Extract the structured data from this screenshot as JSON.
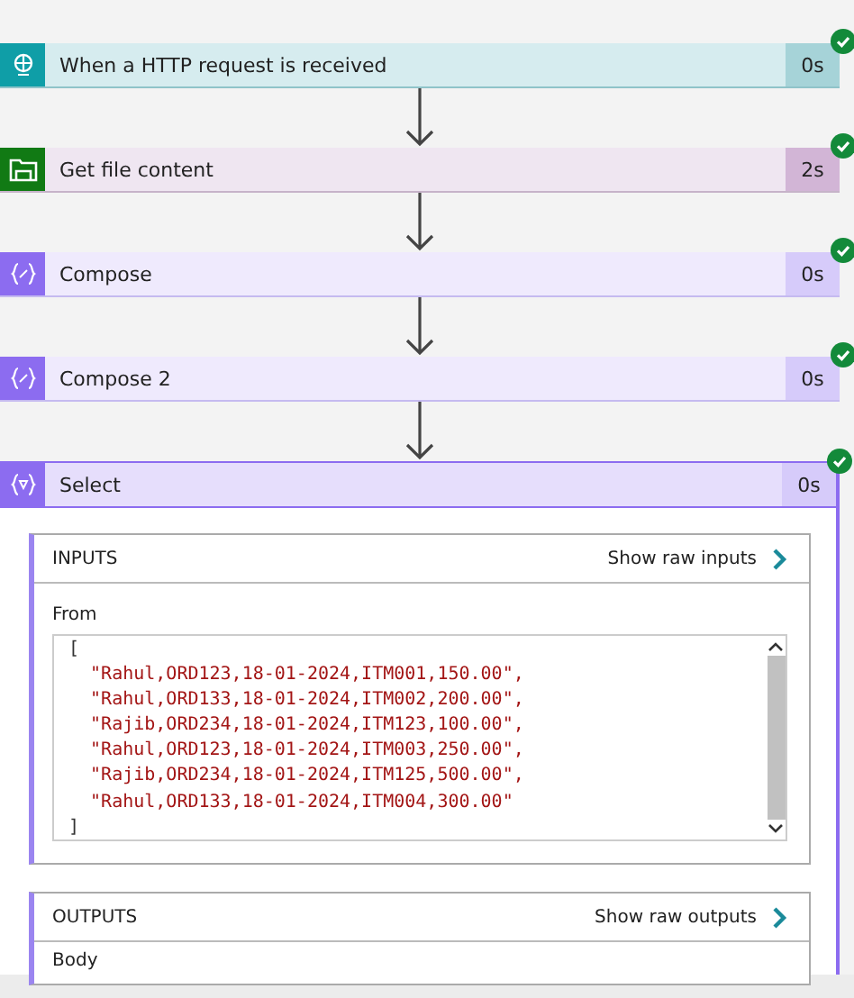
{
  "steps": [
    {
      "kind": "http",
      "title": "When a HTTP request is received",
      "duration": "0s",
      "succeeded": true,
      "expanded": false
    },
    {
      "kind": "file",
      "title": "Get file content",
      "duration": "2s",
      "succeeded": true,
      "expanded": false
    },
    {
      "kind": "compose",
      "title": "Compose",
      "duration": "0s",
      "succeeded": true,
      "expanded": false
    },
    {
      "kind": "compose",
      "title": "Compose 2",
      "duration": "0s",
      "succeeded": true,
      "expanded": false
    },
    {
      "kind": "select",
      "title": "Select",
      "duration": "0s",
      "succeeded": true,
      "expanded": true
    }
  ],
  "inputs": {
    "title": "INPUTS",
    "link": "Show raw inputs",
    "field_label": "From",
    "code_lines": [
      "[",
      "  \"Rahul,ORD123,18-01-2024,ITM001,150.00\",",
      "  \"Rahul,ORD133,18-01-2024,ITM002,200.00\",",
      "  \"Rajib,ORD234,18-01-2024,ITM123,100.00\",",
      "  \"Rahul,ORD123,18-01-2024,ITM003,250.00\",",
      "  \"Rajib,ORD234,18-01-2024,ITM125,500.00\",",
      "  \"Rahul,ORD133,18-01-2024,ITM004,300.00\"",
      "]"
    ]
  },
  "outputs": {
    "title": "OUTPUTS",
    "link": "Show raw outputs",
    "field_label": "Body"
  }
}
